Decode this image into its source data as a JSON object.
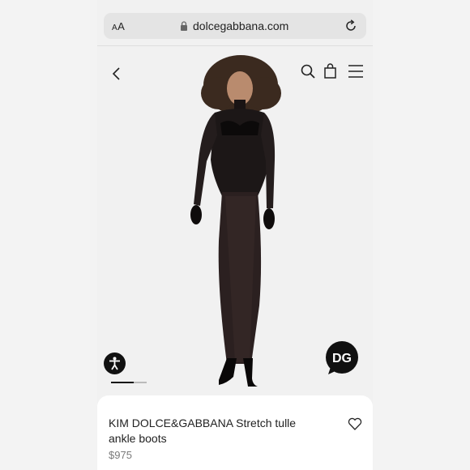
{
  "browser": {
    "text_size_label_small": "A",
    "text_size_label_large": "A",
    "url": "dolcegabbana.com"
  },
  "header": {
    "icons": [
      "back-icon",
      "search-icon",
      "shopping-bag-icon",
      "menu-icon"
    ]
  },
  "gallery": {
    "slide_count": 2,
    "active_slide": 1,
    "badge_logo": "DG"
  },
  "product": {
    "name": "KIM DOLCE&GABBANA Stretch tulle ankle boots",
    "price": "$975"
  },
  "colors": {
    "background": "#f1f1f1",
    "text": "#222222",
    "price": "#7a7a7a",
    "accent": "#111111"
  }
}
